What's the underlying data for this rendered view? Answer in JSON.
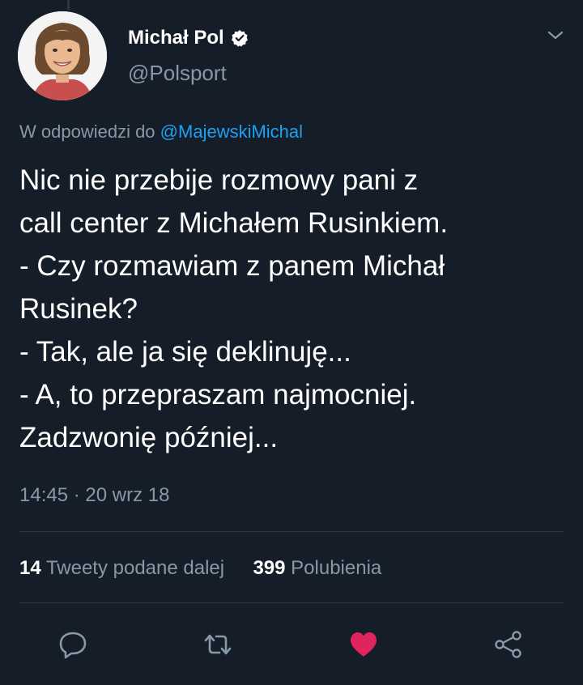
{
  "tweet": {
    "author": {
      "display_name": "Michał Pol",
      "handle": "@Polsport",
      "verified": true
    },
    "reply_to": {
      "prefix": "W odpowiedzi do",
      "mention": "@MajewskiMichal"
    },
    "text_lines": [
      "Nic nie przebije rozmowy pani z",
      "call center z Michałem Rusinkiem.",
      "- Czy rozmawiam z panem Michał",
      "Rusinek?",
      "- Tak, ale ja się deklinuję...",
      "- A, to przepraszam najmocniej.",
      "Zadzwonię później..."
    ],
    "timestamp": "14:45 · 20 wrz 18",
    "stats": {
      "retweets_count": "14",
      "retweets_label": "Tweety podane dalej",
      "likes_count": "399",
      "likes_label": "Polubienia"
    },
    "actions": [
      "reply-icon",
      "retweet-icon",
      "heart-icon",
      "share-icon"
    ]
  },
  "colors": {
    "background": "#151d28",
    "text_primary": "#ffffff",
    "text_secondary": "#8899a6",
    "link": "#1da1f2",
    "like": "#e0245e",
    "divider": "#2b3847"
  }
}
